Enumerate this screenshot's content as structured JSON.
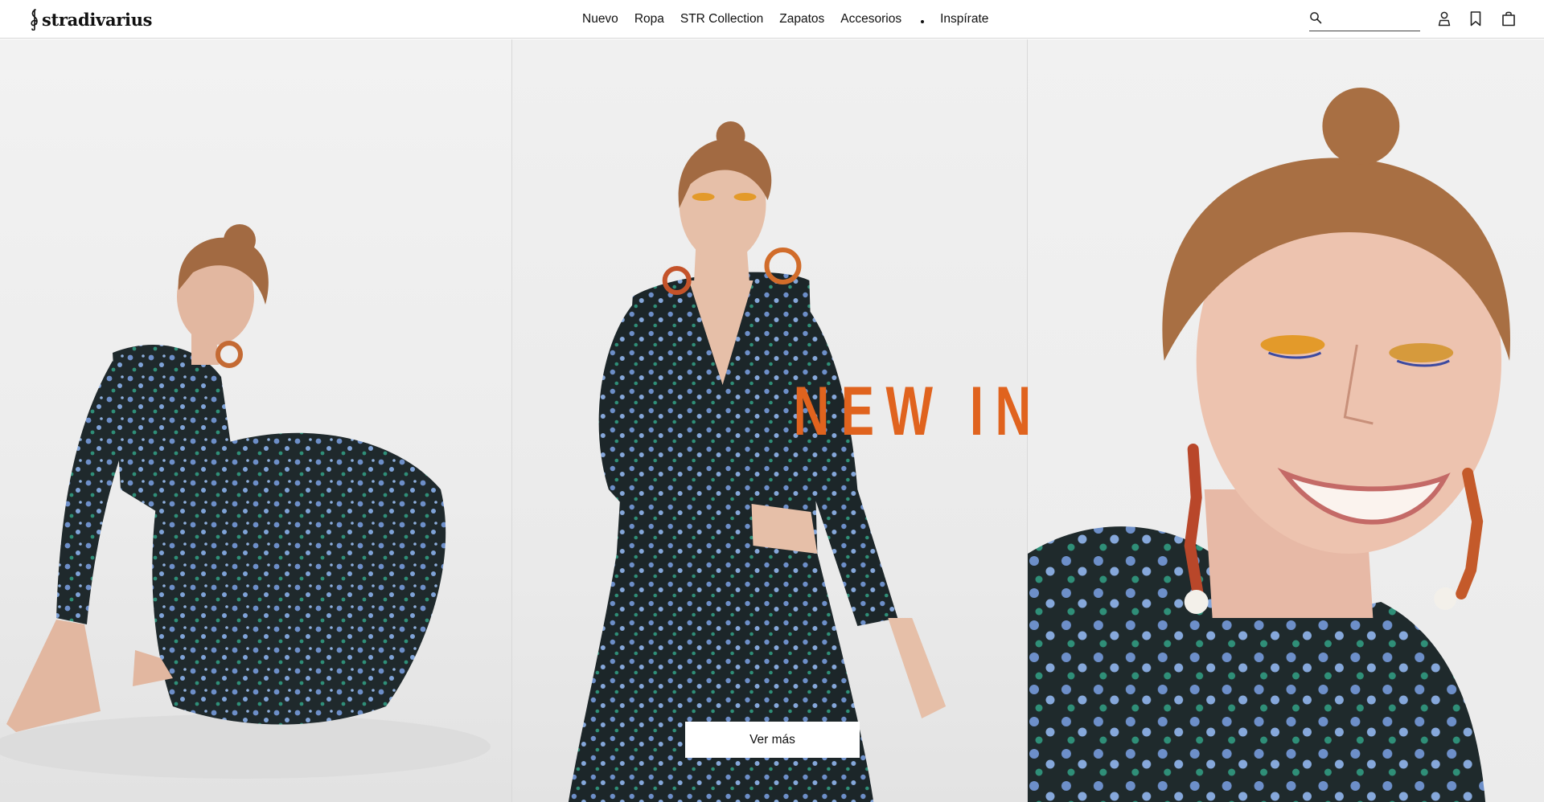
{
  "header": {
    "logo_text": "stradivarius",
    "nav": [
      "Nuevo",
      "Ropa",
      "STR Collection",
      "Zapatos",
      "Accesorios",
      "Inspírate"
    ],
    "search_placeholder": "",
    "icons": [
      "search-icon",
      "user-icon",
      "bookmark-icon",
      "bag-icon"
    ]
  },
  "hero": {
    "headline": "NEW IN",
    "cta_label": "Ver más",
    "panels": [
      "model-seated-floral-dress",
      "model-standing-floral-dress",
      "model-smiling-closeup"
    ]
  },
  "colors": {
    "accent": "#e0631e",
    "dress_dark": "#1d2a2e",
    "dress_flower": "#6d8fc9",
    "dress_leaf": "#2f8f78",
    "skin": "#e2b7a0",
    "hair": "#a26a42",
    "header_bg": "#ffffff",
    "border": "#d6d6d6"
  }
}
